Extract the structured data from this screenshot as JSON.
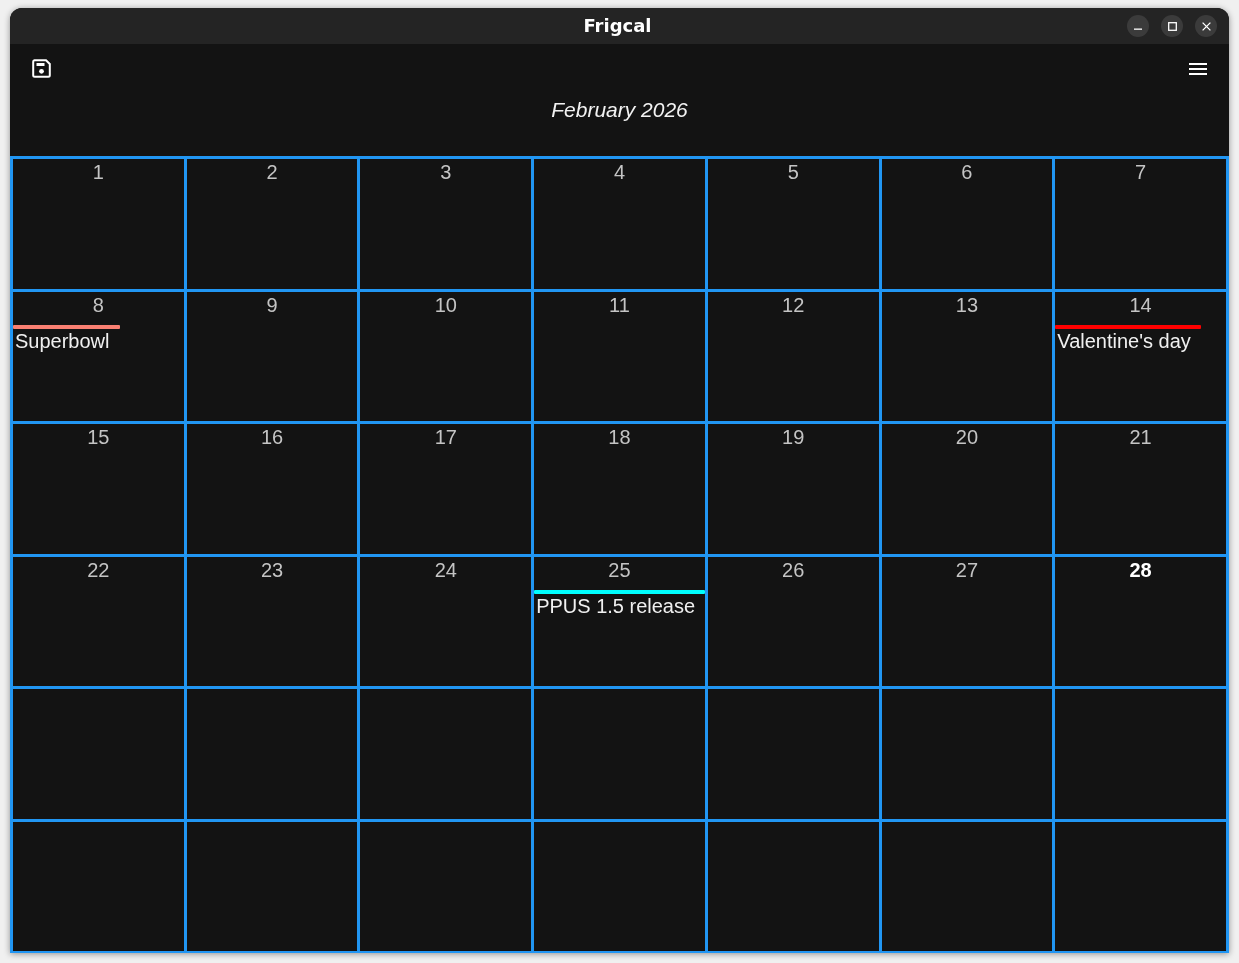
{
  "window": {
    "title": "Frigcal"
  },
  "month_title": "February 2026",
  "weeks": [
    {
      "days": [
        {
          "kind": "date",
          "day": "1",
          "today": false
        },
        {
          "kind": "date",
          "day": "2",
          "today": false
        },
        {
          "kind": "date",
          "day": "3",
          "today": false
        },
        {
          "kind": "date",
          "day": "4",
          "today": false
        },
        {
          "kind": "date",
          "day": "5",
          "today": false
        },
        {
          "kind": "date",
          "day": "6",
          "today": false
        },
        {
          "kind": "date",
          "day": "7",
          "today": false
        }
      ]
    },
    {
      "days": [
        {
          "kind": "date",
          "day": "8",
          "today": false,
          "events": [
            {
              "title": "Superbowl",
              "color": "#fa8072"
            }
          ]
        },
        {
          "kind": "date",
          "day": "9",
          "today": false
        },
        {
          "kind": "date",
          "day": "10",
          "today": false
        },
        {
          "kind": "date",
          "day": "11",
          "today": false
        },
        {
          "kind": "date",
          "day": "12",
          "today": false
        },
        {
          "kind": "date",
          "day": "13",
          "today": false
        },
        {
          "kind": "date",
          "day": "14",
          "today": false,
          "events": [
            {
              "title": "Valentine's day",
              "color": "#ff0000"
            }
          ]
        }
      ]
    },
    {
      "days": [
        {
          "kind": "date",
          "day": "15",
          "today": false
        },
        {
          "kind": "date",
          "day": "16",
          "today": false
        },
        {
          "kind": "date",
          "day": "17",
          "today": false
        },
        {
          "kind": "date",
          "day": "18",
          "today": false
        },
        {
          "kind": "date",
          "day": "19",
          "today": false
        },
        {
          "kind": "date",
          "day": "20",
          "today": false
        },
        {
          "kind": "date",
          "day": "21",
          "today": false
        }
      ]
    },
    {
      "days": [
        {
          "kind": "date",
          "day": "22",
          "today": false
        },
        {
          "kind": "date",
          "day": "23",
          "today": false
        },
        {
          "kind": "date",
          "day": "24",
          "today": false
        },
        {
          "kind": "date",
          "day": "25",
          "today": false,
          "events": [
            {
              "title": "PPUS 1.5 release",
              "color": "#00ffff"
            }
          ]
        },
        {
          "kind": "date",
          "day": "26",
          "today": false
        },
        {
          "kind": "date",
          "day": "27",
          "today": false
        },
        {
          "kind": "date",
          "day": "28",
          "today": true
        }
      ]
    },
    {
      "days": [
        {
          "kind": "blank"
        },
        {
          "kind": "blank"
        },
        {
          "kind": "blank"
        },
        {
          "kind": "blank"
        },
        {
          "kind": "blank"
        },
        {
          "kind": "blank"
        },
        {
          "kind": "blank"
        }
      ]
    },
    {
      "days": [
        {
          "kind": "blank"
        },
        {
          "kind": "blank"
        },
        {
          "kind": "blank"
        },
        {
          "kind": "blank"
        },
        {
          "kind": "blank"
        },
        {
          "kind": "blank"
        },
        {
          "kind": "blank"
        }
      ]
    }
  ]
}
